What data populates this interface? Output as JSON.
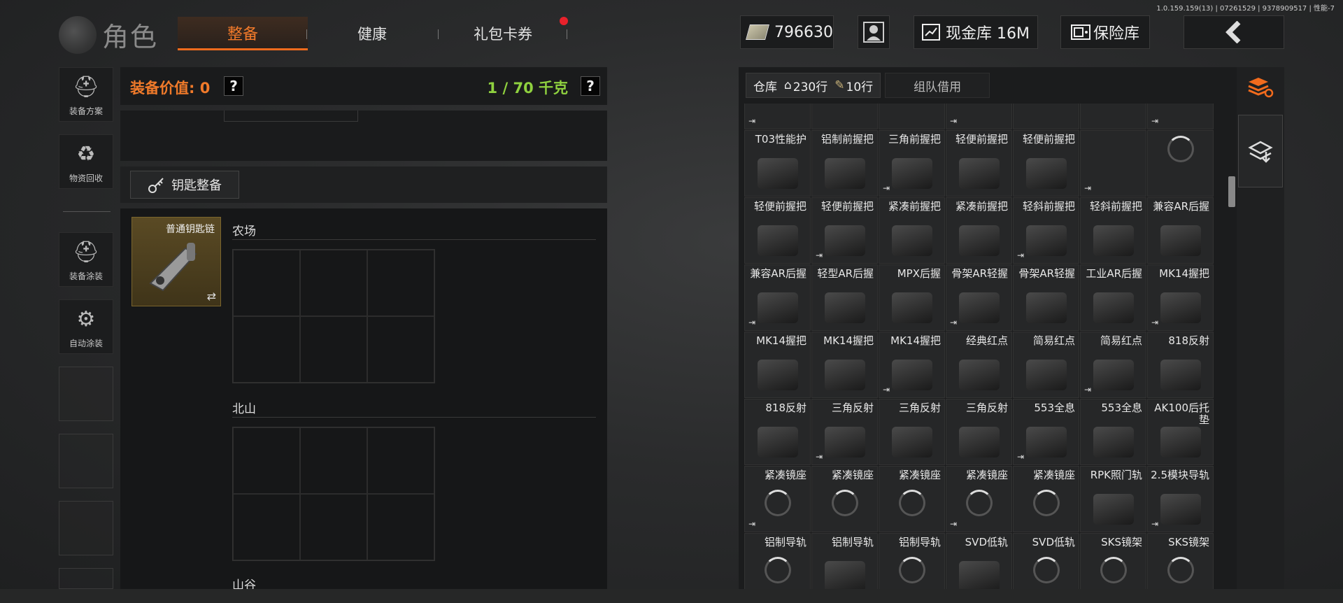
{
  "version": "1.0.159.159(13) | 07261529 | 9378909517 | 性能-7",
  "header": {
    "title": "角色",
    "tabs": [
      {
        "label": "整备",
        "active": true
      },
      {
        "label": "健康"
      },
      {
        "label": "礼包卡券",
        "badge": "red-dot"
      }
    ],
    "money": "796630",
    "cash_vault": "现金库 16M",
    "safe": "保险库",
    "back_icon": "chevron-left-icon"
  },
  "sidebar": {
    "items": [
      {
        "label": "装备方案",
        "icon": "helmet-gear-icon"
      },
      {
        "label": "物资回收",
        "icon": "recycle-bag-icon"
      },
      {
        "label": "装备涂装",
        "icon": "helmet-paint-icon"
      },
      {
        "label": "自动涂装",
        "icon": "brush-gear-icon"
      }
    ]
  },
  "equipment": {
    "value_label": "装备价值: 0",
    "weight_label": "1 / 70 千克",
    "help": "?",
    "key_button": "钥匙整备",
    "keychain_name": "普通钥匙链",
    "regions": [
      "农场",
      "北山",
      "山谷"
    ]
  },
  "warehouse": {
    "tab_label": "仓库",
    "rows_house": "230行",
    "rows_key": "10行",
    "team_tab": "组队借用",
    "items": [
      [
        "",
        "",
        "",
        "",
        "",
        "",
        ""
      ],
      [
        "T03性能护",
        "铝制前握把",
        "三角前握把",
        "轻便前握把",
        "轻便前握把",
        "",
        ""
      ],
      [
        "轻便前握把",
        "轻便前握把",
        "紧凑前握把",
        "紧凑前握把",
        "轻斜前握把",
        "轻斜前握把",
        "兼容AR后握"
      ],
      [
        "兼容AR后握",
        "轻型AR后握",
        "MPX后握",
        "骨架AR轻握",
        "骨架AR轻握",
        "工业AR后握",
        "MK14握把"
      ],
      [
        "MK14握把",
        "MK14握把",
        "MK14握把",
        "经典红点",
        "简易红点",
        "简易红点",
        "818反射"
      ],
      [
        "818反射",
        "三角反射",
        "三角反射",
        "三角反射",
        "553全息",
        "553全息",
        "AK100后托垫"
      ],
      [
        "紧凑镜座",
        "紧凑镜座",
        "紧凑镜座",
        "紧凑镜座",
        "紧凑镜座",
        "RPK照门轨",
        "2.5模块导轨"
      ],
      [
        "铝制导轨",
        "铝制导轨",
        "铝制导轨",
        "SVD低轨",
        "SVD低轨",
        "SKS镜架",
        "SKS镜架"
      ]
    ]
  },
  "colors": {
    "accent": "#f26b1d",
    "weight": "#8fd13f",
    "badge": "#e8212b"
  }
}
